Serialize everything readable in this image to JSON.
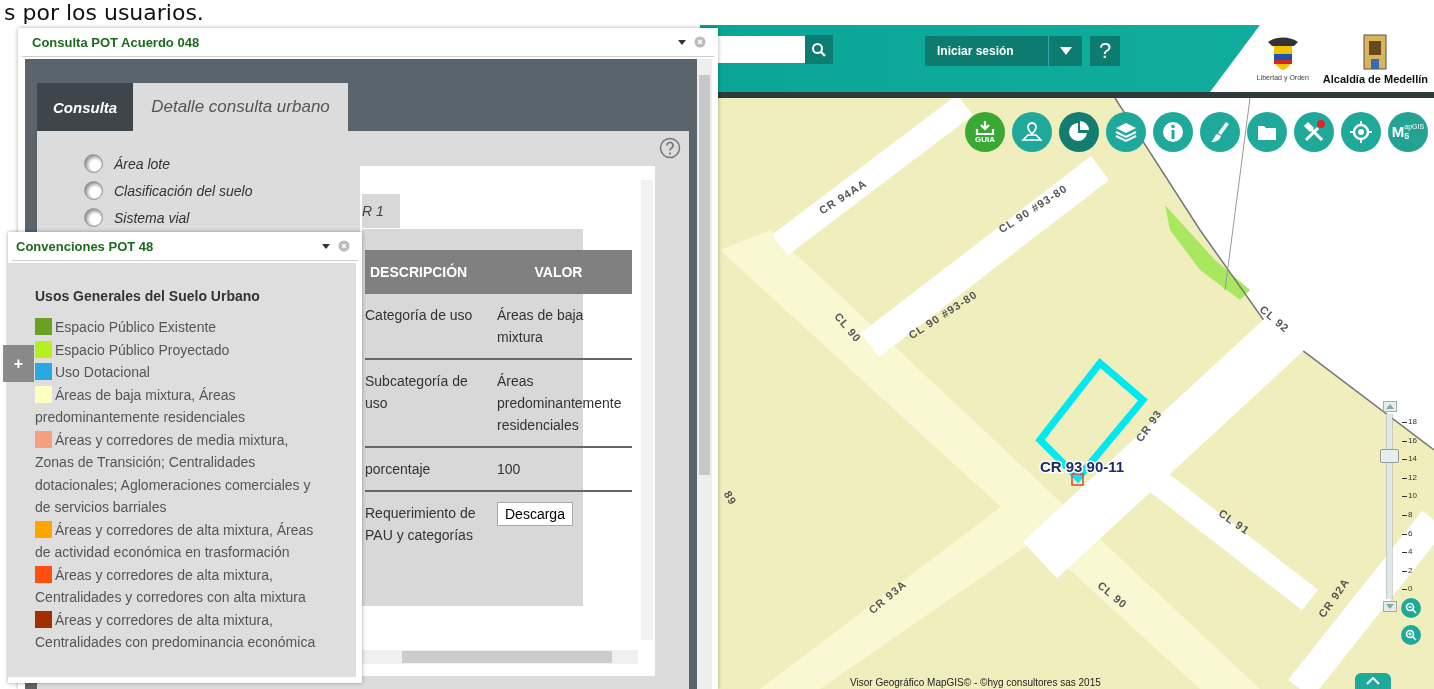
{
  "slide_caption": "s por los usuarios.",
  "consulta_panel": {
    "title": "Consulta POT Acuerdo 048",
    "tabs": [
      {
        "label": "Consulta",
        "selected": false
      },
      {
        "label": "Detalle consulta urbano",
        "selected": true
      }
    ],
    "options": [
      {
        "label": "Área lote",
        "selected": false
      },
      {
        "label": "Clasificación del suelo",
        "selected": false
      },
      {
        "label": "Sistema vial",
        "selected": false
      }
    ],
    "result": {
      "tab_label": "R 1",
      "columns": [
        "DESCRIPCIÓN",
        "VALOR"
      ],
      "rows": [
        {
          "kind": "text",
          "description": "Categoría de uso",
          "value": "Áreas de baja mixtura"
        },
        {
          "kind": "text",
          "description": "Subcategoría de uso",
          "value": "Áreas predominantemente residenciales"
        },
        {
          "kind": "text",
          "description": "porcentaje",
          "value": "100"
        },
        {
          "kind": "button",
          "description": "Requerimiento de PAU y categorías",
          "value": "Descarga"
        }
      ]
    }
  },
  "legend_panel": {
    "title": "Convenciones POT 48",
    "heading": "Usos Generales del Suelo Urbano",
    "items": [
      {
        "label": "Espacio Público Existente",
        "color": "#6aa121"
      },
      {
        "label": "Espacio Público Proyectado",
        "color": "#b4f01e"
      },
      {
        "label": "Uso Dotacional",
        "color": "#29a9e1"
      },
      {
        "label": "Áreas de baja mixtura, Áreas predominantemente residenciales",
        "color": "#ffffc0"
      },
      {
        "label": "Áreas y corredores de media mixtura, Zonas de Transición; Centralidades dotacionales; Aglomeraciones comerciales y de servicios barriales",
        "color": "#f4a07e"
      },
      {
        "label": "Áreas y corredores de alta mixtura, Áreas de actividad económica en trasformación",
        "color": "#ffa500"
      },
      {
        "label": "Áreas y corredores de alta mixtura, Centralidades y corredores con alta mixtura",
        "color": "#ff5010"
      },
      {
        "label": "Áreas y corredores de alta mixtura, Centralidades con predominancia económica",
        "color": "#a03000"
      }
    ]
  },
  "expand_button": "+",
  "header": {
    "login_button": "Iniciar sesión",
    "help_button": "?",
    "motto": "Libertad y Orden",
    "city": "Alcaldía de Medellín"
  },
  "toolbar": {
    "guide_label": "GUIA",
    "logo": {
      "big": "M",
      "small": "apGIS",
      "sub": "5"
    }
  },
  "map": {
    "streets": [
      "CR 94AA",
      "CL 90 #93-80",
      "CL 90 #93-80",
      "CL 90",
      "CL 92",
      "CR 93",
      "CL 91",
      "CR 92A",
      "CR 93A",
      "CL 90",
      "89"
    ],
    "address": "CR 93 90-11",
    "zoom": {
      "level": 0.8,
      "ticks": [
        "18",
        "16",
        "14",
        "12",
        "10",
        "8",
        "6",
        "4",
        "2",
        "0"
      ]
    },
    "attribution": "Visor Geográfico MapGIS© - ©hyg consultores sas 2015"
  }
}
